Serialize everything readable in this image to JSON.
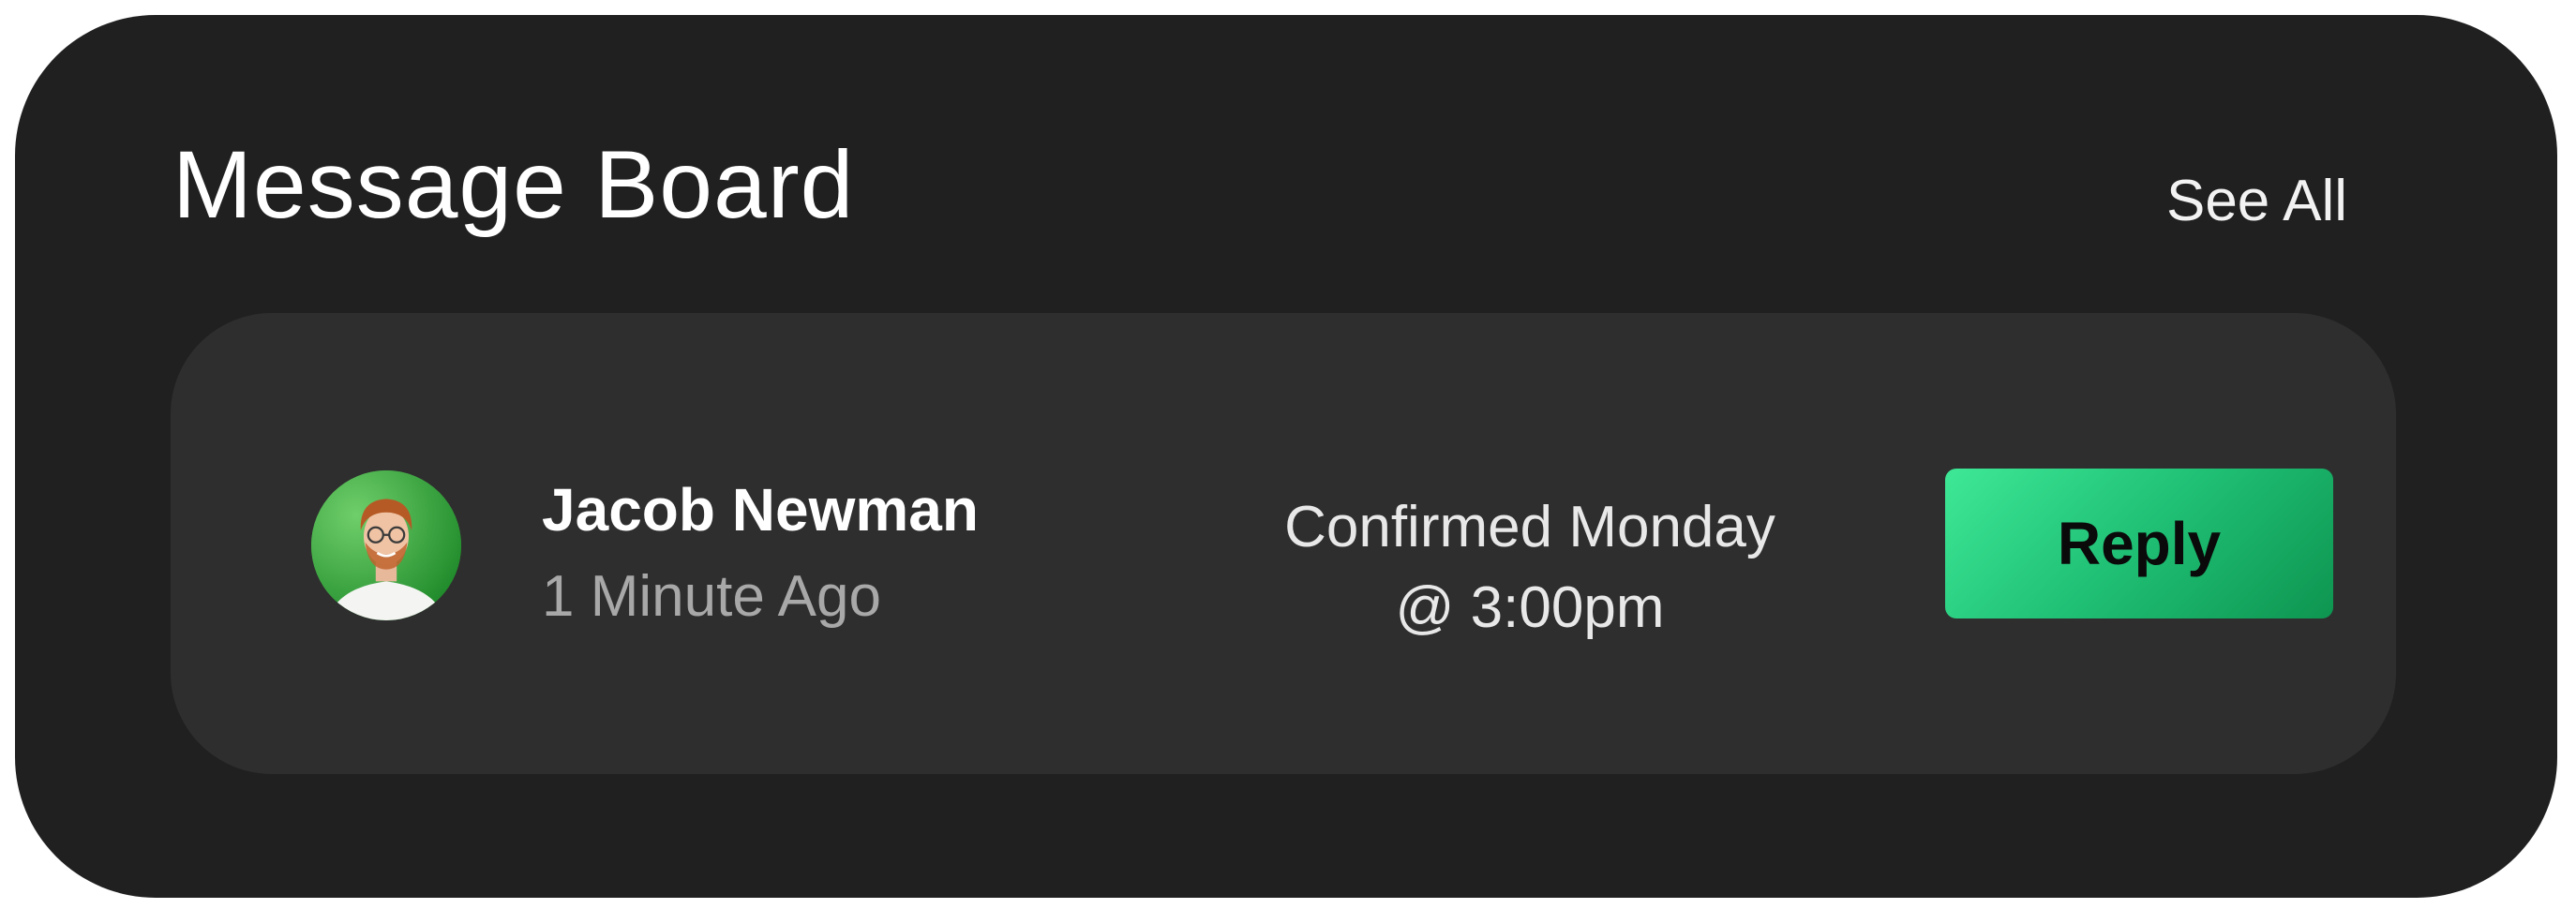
{
  "header": {
    "title": "Message Board",
    "see_all_label": "See All"
  },
  "message": {
    "author": "Jacob Newman",
    "time_ago": "1 Minute Ago",
    "text_line_1": "Confirmed Monday",
    "text_line_2": "@ 3:00pm",
    "reply_label": "Reply",
    "avatar_icon": "user-avatar-photo"
  },
  "colors": {
    "card_background": "#202020",
    "item_background": "#2e2e2e",
    "accent_gradient_start": "#3ee896",
    "accent_gradient_end": "#0e9550",
    "avatar_background": "#3aa53a"
  }
}
